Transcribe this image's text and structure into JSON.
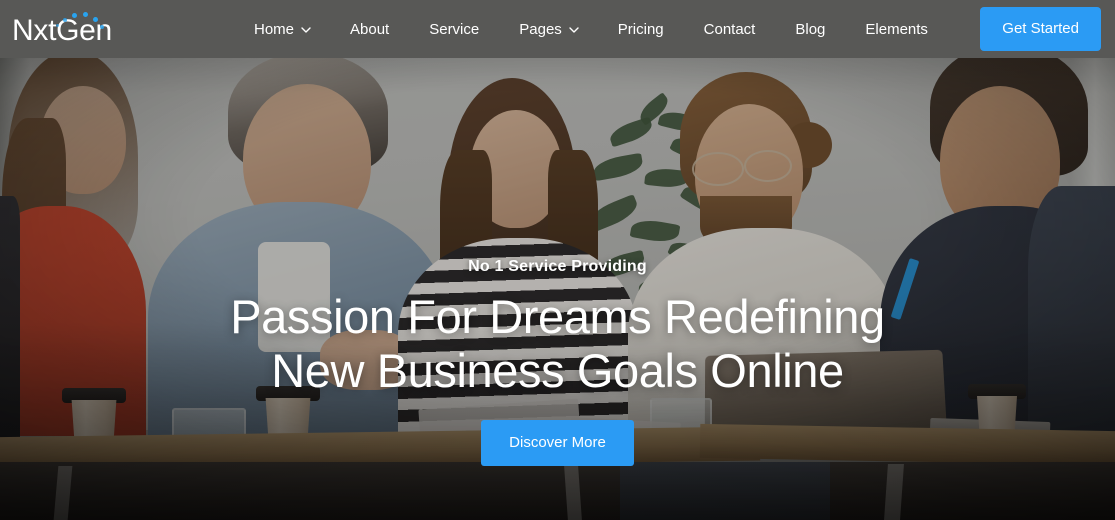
{
  "brand": {
    "name": "NxtGen",
    "logo_dot_color": "#29a3ef"
  },
  "header": {
    "background_color": "#585856",
    "nav_items": [
      {
        "label": "Home",
        "has_dropdown": true,
        "icon": "chevron-down-icon"
      },
      {
        "label": "About",
        "has_dropdown": false
      },
      {
        "label": "Service",
        "has_dropdown": false
      },
      {
        "label": "Pages",
        "has_dropdown": true,
        "icon": "chevron-down-icon"
      },
      {
        "label": "Pricing",
        "has_dropdown": false
      },
      {
        "label": "Contact",
        "has_dropdown": false
      },
      {
        "label": "Blog",
        "has_dropdown": false
      },
      {
        "label": "Elements",
        "has_dropdown": false
      }
    ],
    "cta": {
      "label": "Get Started",
      "color": "#2b9bf4"
    }
  },
  "hero": {
    "eyebrow": "No 1 Service Providing",
    "headline_line1": "Passion For Dreams Redefining",
    "headline_line2": "New Business Goals Online",
    "cta": {
      "label": "Discover More",
      "color": "#2b9bf4"
    },
    "background": "business-team-meeting-photo"
  }
}
